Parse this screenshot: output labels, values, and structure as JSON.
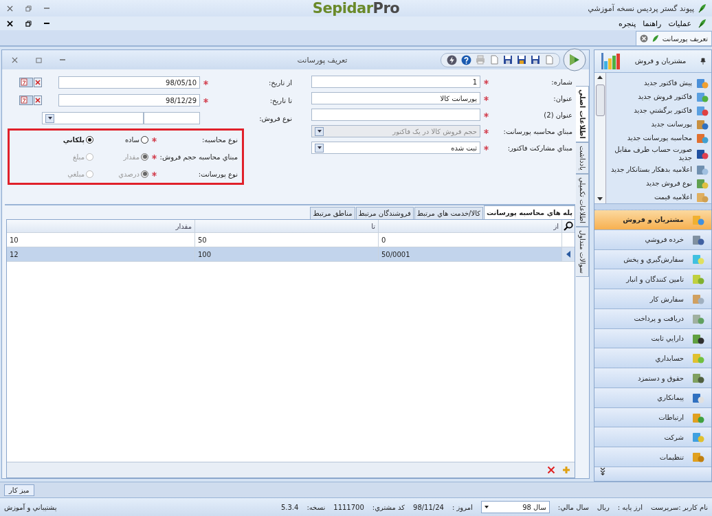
{
  "app": {
    "title": "پيوند گستر پرديس نسخه آموزشي",
    "logo_main": "Sepidar",
    "logo_accent": "Pro"
  },
  "menu": [
    "عمليات",
    "راهنما",
    "پنجره"
  ],
  "doc_tabs": [
    {
      "label": "تعريف پورسانت"
    }
  ],
  "form_window": {
    "title": "تعريف پورسانت"
  },
  "vertical_tabs": [
    {
      "label": "اطلاعات اصلي",
      "selected": true
    },
    {
      "label": "يادداشت",
      "selected": false
    },
    {
      "label": "اطلاعات تکميلي",
      "selected": false
    },
    {
      "label": "سوالات متداول",
      "selected": false
    }
  ],
  "fields_right": [
    {
      "kind": "text",
      "label": "شماره:",
      "required": true,
      "value": "1",
      "disabled": false
    },
    {
      "kind": "text",
      "label": "عنوان:",
      "required": true,
      "value": "پورسانت کالا",
      "disabled": false
    },
    {
      "kind": "text",
      "label": "عنوان (2)",
      "required": true,
      "disabled": false
    },
    {
      "kind": "dropdown",
      "label": "مبناي محاسبه پورسانت:",
      "required": true,
      "value": "حجم فروش کالا در يک فاکتور",
      "disabled": true
    },
    {
      "kind": "dropdown",
      "label": "مبناي مشارکت فاکتور:",
      "required": true,
      "value": "ثبت شده",
      "disabled": false
    }
  ],
  "fields_left": [
    {
      "kind": "date",
      "label": "از تاريخ:",
      "required": true,
      "value": "98/05/10"
    },
    {
      "kind": "date",
      "label": "تا تاريخ:",
      "required": true,
      "value": "98/12/29"
    },
    {
      "kind": "combo",
      "label": "نوع فروش:",
      "required": false
    }
  ],
  "radio_rows": [
    {
      "label": "نوع محاسبه:",
      "required": true,
      "options": [
        {
          "label": "ساده",
          "selected": false,
          "disabled": false
        },
        {
          "label": "پلکاني",
          "selected": true,
          "disabled": false
        }
      ]
    },
    {
      "label": "مبناي محاسبه حجم فروش:",
      "required": true,
      "options": [
        {
          "label": "مقدار",
          "selected": true,
          "disabled": true
        },
        {
          "label": "مبلغ",
          "selected": false,
          "disabled": true
        }
      ]
    },
    {
      "label": "نوع پورسانت:",
      "required": true,
      "options": [
        {
          "label": "درصدي",
          "selected": true,
          "disabled": true
        },
        {
          "label": "مبلغي",
          "selected": false,
          "disabled": true
        }
      ]
    }
  ],
  "grid_tabs": [
    {
      "label": "پله هاي محاسبه پورسانت",
      "selected": true
    },
    {
      "label": "کالا/خدمت هاي مرتبط",
      "selected": false
    },
    {
      "label": "فروشندگان مرتبط",
      "selected": false
    },
    {
      "label": "مناطق مرتبط",
      "selected": false
    }
  ],
  "grid": {
    "columns": [
      "از",
      "تا",
      "مقدار"
    ],
    "rows": [
      {
        "cells": [
          "0",
          "50",
          "10"
        ],
        "selected": false
      },
      {
        "cells": [
          "50/0001",
          "100",
          "12"
        ],
        "selected": true
      }
    ]
  },
  "sidebar": {
    "title": "مشتريان و فروش",
    "shortcuts": [
      "پيش فاکتور جديد",
      "فاکتور فروش جديد",
      "فاکتور برگشتي جديد",
      "پورسانت جديد",
      "محاسبه پورسانت جديد",
      "صورت حساب طرف مقابل جديد",
      "اعلاميه بدهکار بستانکار جديد",
      "نوع فروش جديد",
      "اعلاميه قيمت"
    ],
    "modules": [
      {
        "label": "مشتريان و فروش",
        "selected": true
      },
      {
        "label": "خرده فروشي",
        "selected": false
      },
      {
        "label": "سفارش‌گيري و پخش",
        "selected": false
      },
      {
        "label": "تامين کنندگان و انبار",
        "selected": false
      },
      {
        "label": "سفارش کار",
        "selected": false
      },
      {
        "label": "دريافت و پرداخت",
        "selected": false
      },
      {
        "label": "دارايي ثابت",
        "selected": false
      },
      {
        "label": "حسابداري",
        "selected": false
      },
      {
        "label": "حقوق و دستمزد",
        "selected": false
      },
      {
        "label": "پيمانکاري",
        "selected": false
      },
      {
        "label": "ارتباطات",
        "selected": false
      },
      {
        "label": "شرکت",
        "selected": false
      },
      {
        "label": "تنظيمات",
        "selected": false
      }
    ]
  },
  "desk_button": "ميز کار",
  "status_bar": {
    "user": "نام کاربر :سرپرست",
    "currency_label": "ارز پايه :",
    "currency": "ريال",
    "year_label": "سال مالي:",
    "year": "سال 98",
    "today_label": "امروز :",
    "today": "98/11/24",
    "customer_label": "کد مشتري:",
    "customer": "1111700",
    "version_label": "نسخه:",
    "version": "5.3.4",
    "support": "پشتيباني و آموزش"
  }
}
